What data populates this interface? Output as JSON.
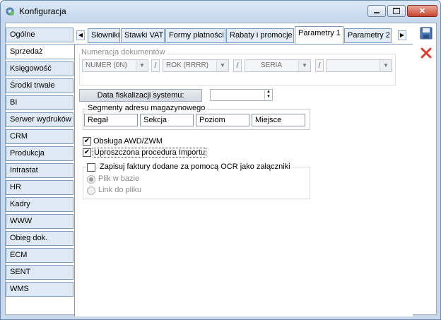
{
  "window": {
    "title": "Konfiguracja"
  },
  "left_tabs": [
    "Ogólne",
    "Sprzedaż",
    "Księgowość",
    "Środki trwałe",
    "BI",
    "Serwer wydruków",
    "CRM",
    "Produkcja",
    "Intrastat",
    "HR",
    "Kadry",
    "WWW",
    "Obieg dok.",
    "ECM",
    "SENT",
    "WMS"
  ],
  "left_active": "Sprzedaż",
  "top_tabs": [
    "Słowniki",
    "Stawki VAT",
    "Formy płatności",
    "Rabaty i promocje",
    "Parametry 1",
    "Parametry 2"
  ],
  "top_active": "Parametry 1",
  "numeracja": {
    "label": "Numeracja dokumentów",
    "combo1": "NUMER (0N)",
    "combo2": "ROK (RRRR)",
    "combo3": "SERIA",
    "combo4": "",
    "separator": "/"
  },
  "fiskal": {
    "label": "Data fiskalizacji systemu:",
    "value": ""
  },
  "segmenty": {
    "label": "Segmenty adresu magazynowego",
    "cells": [
      "Regał",
      "Sekcja",
      "Poziom",
      "Miejsce"
    ]
  },
  "checks": {
    "awd": {
      "label": "Obsługa AWD/ZWM",
      "checked": true
    },
    "import": {
      "label": "Uproszczona procedura Importu",
      "checked": true
    },
    "ocr": {
      "label": "Zapisuj faktury dodane za pomocą OCR jako załączniki",
      "checked": false
    }
  },
  "radios": {
    "plik": "Plik w bazie",
    "link": "Link do pliku"
  },
  "colors": {
    "accent": "#7a9cc4",
    "close": "#c7452e"
  }
}
